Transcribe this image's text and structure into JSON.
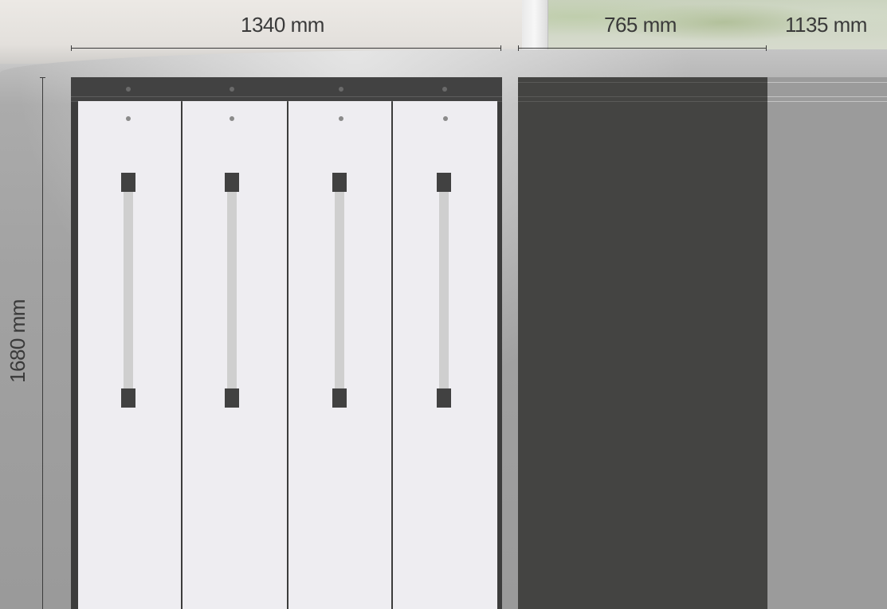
{
  "dimensions": {
    "width_label": "1340 mm",
    "depth_label": "765 mm",
    "extra_label": "1135 mm",
    "height_label": "1680 mm"
  },
  "colors": {
    "cabinet_frame": "#3c3c3c",
    "door_face": "#eeedf1",
    "handle_bar": "#cfcfcf",
    "handle_cap": "#414141",
    "side_panel": "#444442",
    "dimension_text": "#3a3a3a"
  },
  "cabinet": {
    "door_count": 4,
    "handles": [
      "handle",
      "handle",
      "handle",
      "handle"
    ]
  }
}
